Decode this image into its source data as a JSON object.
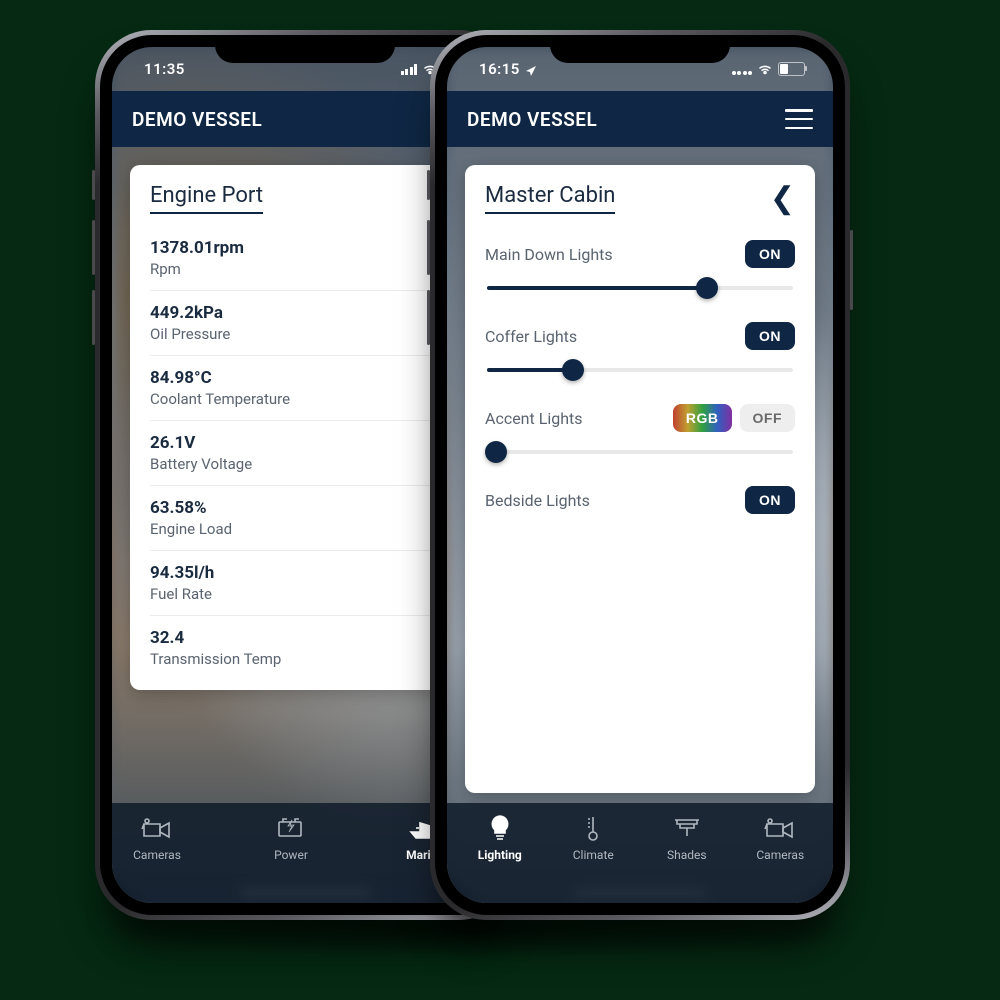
{
  "phone1": {
    "status": {
      "time": "11:35"
    },
    "app_title": "DEMO VESSEL",
    "card_title": "Engine Port",
    "stats": [
      {
        "value": "1378.01rpm",
        "label": "Rpm"
      },
      {
        "value": "449.2kPa",
        "label": "Oil Pressure"
      },
      {
        "value": "84.98°C",
        "label": "Coolant Temperature"
      },
      {
        "value": "26.1V",
        "label": "Battery Voltage"
      },
      {
        "value": "63.58%",
        "label": "Engine Load"
      },
      {
        "value": "94.35l/h",
        "label": "Fuel Rate"
      },
      {
        "value": "32.4",
        "label": "Transmission Temp"
      }
    ],
    "tabs": [
      {
        "label": "Cameras",
        "icon": "camera",
        "active": false,
        "truncated": true
      },
      {
        "label": "Power",
        "icon": "battery",
        "active": false
      },
      {
        "label": "Marine",
        "icon": "boat",
        "active": true
      }
    ]
  },
  "phone2": {
    "status": {
      "time": "16:15",
      "location": true
    },
    "app_title": "DEMO VESSEL",
    "card_title": "Master Cabin",
    "lights": [
      {
        "name": "Main Down Lights",
        "state": "ON",
        "has_rgb": false,
        "level": 72
      },
      {
        "name": "Coffer Lights",
        "state": "ON",
        "has_rgb": false,
        "level": 28
      },
      {
        "name": "Accent Lights",
        "state": "OFF",
        "has_rgb": true,
        "rgb_label": "RGB",
        "level": 3
      },
      {
        "name": "Bedside Lights",
        "state": "ON",
        "has_rgb": false,
        "level": null
      }
    ],
    "tabs": [
      {
        "label": "Lighting",
        "icon": "bulb",
        "active": true
      },
      {
        "label": "Climate",
        "icon": "thermo",
        "active": false
      },
      {
        "label": "Shades",
        "icon": "shade",
        "active": false
      },
      {
        "label": "Cameras",
        "icon": "camera",
        "active": false
      }
    ]
  }
}
